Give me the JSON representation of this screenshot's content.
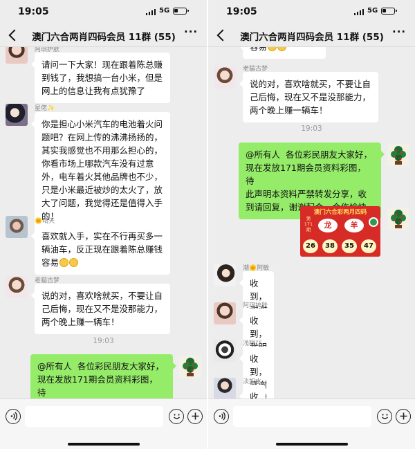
{
  "status": {
    "time": "19:05",
    "network": "5G"
  },
  "nav": {
    "title": "澳门六合两肖四码会员 11群 (55)"
  },
  "left": {
    "top_sender": "阿琪护肤",
    "m1": "请问一下大家！现在跟着陈总赚\n到钱了，我想搞一台小米，但是\n网上的信息让我有点犹豫了",
    "s2": "星佬✨",
    "m2": "你是担心小米汽车的电池着火问\n题吧？在网上传的沸沸扬扬的，\n其实我感觉也不用那么担心的，\n你看市场上哪款汽车没有过意\n外，电车着火其他品牌也不少，\n只是小米最近被炒的太火了，放\n大了问题，我觉得还是值得入手\n的！",
    "s3": "🌞晴天",
    "m3": "喜欢就入手，实在不行再买多一\n辆油车，反正现在跟着陈总赚钱\n容易",
    "s4": "老猫古梦",
    "m4": "说的对，喜欢啥就买，不要让自\n己后悔，现在又不是没那能力，\n两个晚上赚一辆车！",
    "timestamp": "19:03",
    "m5": "@所有人  各位彩民朋友大家好，\n现在发放171期会员资料彩图，待\n此声明本资料严禁转发分享，收\n到请回复，谢谢配合，合作愉快"
  },
  "right": {
    "top_text": "容易",
    "s1": "老猫古梦",
    "m1": "说的对，喜欢啥就买，不要让自\n己后悔，现在又不是没那能力，\n两个晚上赚一辆车！",
    "timestamp": "19:03",
    "m2": "@所有人  各位彩民朋友大家好，\n现在发放171期会员资料彩图，待\n此声明本资料严禁转发分享，收\n到请回复，谢谢配合，合作愉快",
    "poster": {
      "title": "澳门六合彩两月四码",
      "qi": "第\n171\n期",
      "zodiac": [
        "龙",
        "羊"
      ],
      "numbers": [
        "26",
        "38",
        "35",
        "47"
      ]
    },
    "s3": "潮🌞阿敏",
    "m3": "收到，谢谢陈总",
    "s4": "阿琪护肤",
    "m4": "收到，我明白了，谢谢你们！",
    "s5": "浅唱ぴ",
    "m5": "收到，感谢感谢",
    "s6": "淡如水",
    "m6": "收到"
  },
  "input": {
    "placeholder": ""
  },
  "icons": [
    "back-icon",
    "more-icon",
    "voice-icon",
    "emoji-icon",
    "plus-icon",
    "smile-emoji-icon"
  ],
  "colors": {
    "bubble_self": "#95ec69",
    "bubble_other": "#ffffff",
    "chat_bg": "#ededed"
  }
}
